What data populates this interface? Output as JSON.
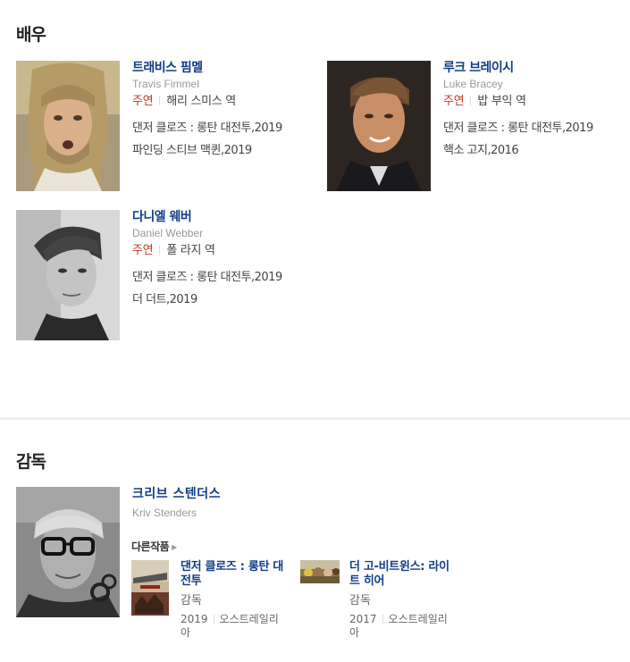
{
  "actors_section": {
    "title": "배우",
    "actors": [
      {
        "name_ko": "트래비스 핌멜",
        "name_en": "Travis Fimmel",
        "role_label": "주연",
        "role_name": "해리 스미스 역",
        "works": [
          "댄저 클로즈 : 롱탄 대전투,2019",
          "파인딩 스티브 맥퀸,2019"
        ]
      },
      {
        "name_ko": "루크 브레이시",
        "name_en": "Luke Bracey",
        "role_label": "주연",
        "role_name": "밥 부익 역",
        "works": [
          "댄저 클로즈 : 롱탄 대전투,2019",
          "핵소 고지,2016"
        ]
      },
      {
        "name_ko": "다니엘 웨버",
        "name_en": "Daniel Webber",
        "role_label": "주연",
        "role_name": "폴 라지 역",
        "works": [
          "댄저 클로즈 : 롱탄 대전투,2019",
          "더 더트,2019"
        ]
      }
    ]
  },
  "director_section": {
    "title": "감독",
    "director": {
      "name_ko": "크리브 스텐더스",
      "name_en": "Kriv Stenders"
    },
    "other_works_label": "다른작품",
    "films": [
      {
        "title": "댄저 클로즈 : 롱탄 대전투",
        "role": "감독",
        "year": "2019",
        "country": "오스트레일리아"
      },
      {
        "title": "더 고-비트윈스: 라이트 히어",
        "role": "감독",
        "year": "2017",
        "country": "오스트레일리아"
      }
    ]
  }
}
